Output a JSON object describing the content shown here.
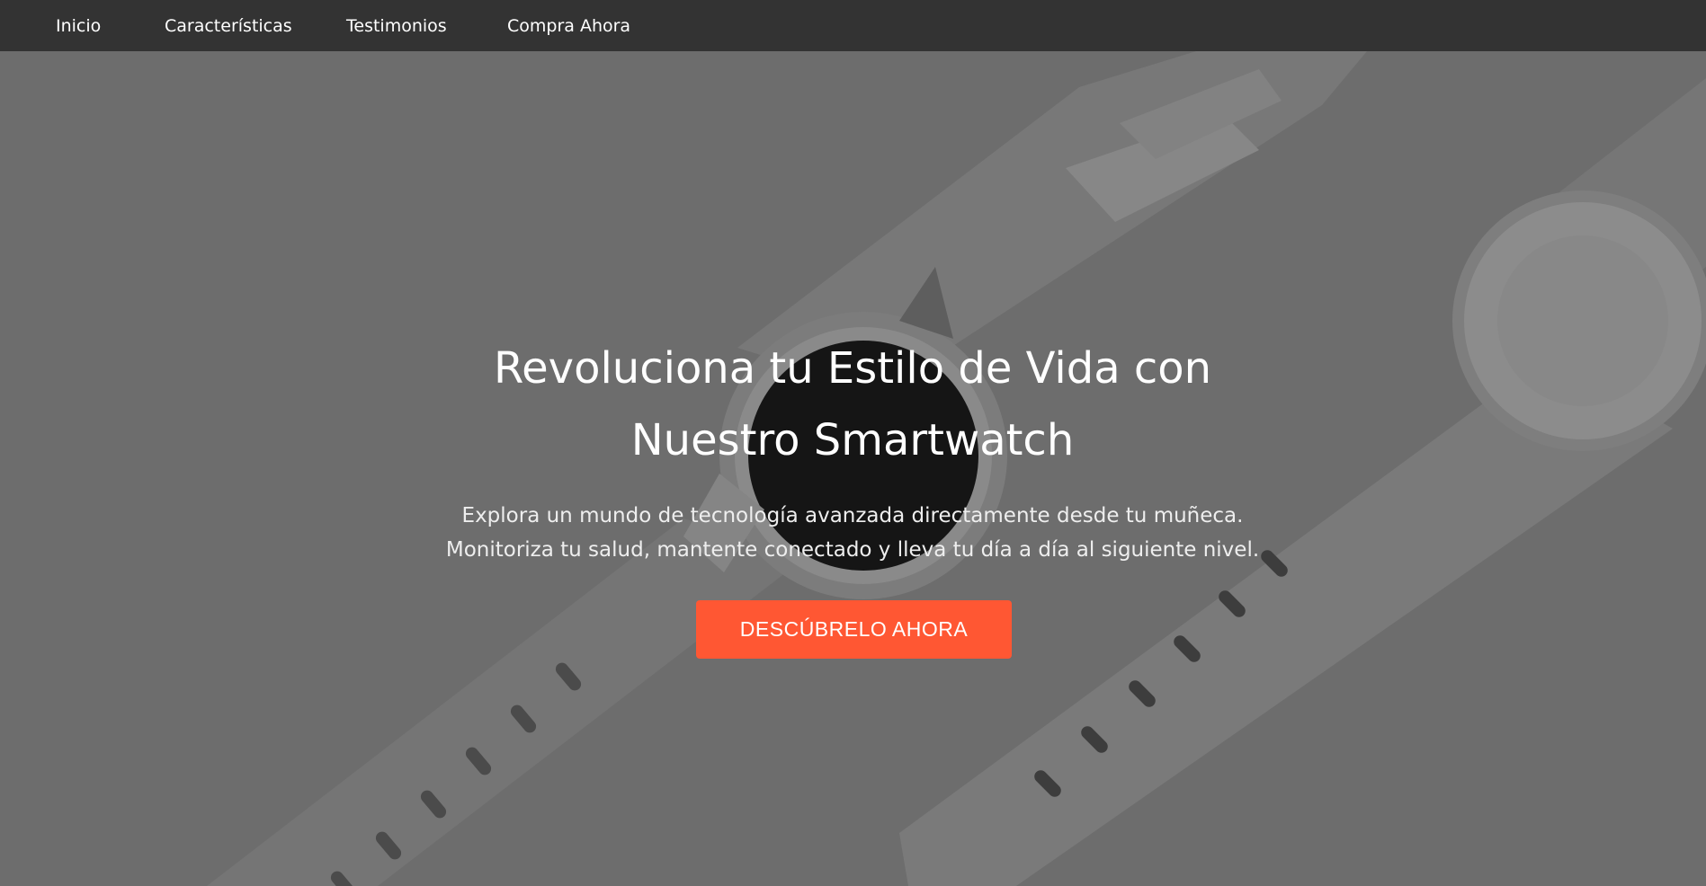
{
  "nav": {
    "items": [
      {
        "label": "Inicio"
      },
      {
        "label": "Características"
      },
      {
        "label": "Testimonios"
      },
      {
        "label": "Compra Ahora"
      }
    ]
  },
  "hero": {
    "title": "Revoluciona tu Estilo de Vida con Nuestro Smartwatch",
    "subtitle_line1": "Explora un mundo de tecnología avanzada directamente desde tu muñeca.",
    "subtitle_line2": "Monitoriza tu salud, mantente conectado y lleva tu día a día al siguiente nivel.",
    "cta_label": "DESCÚBRELO AHORA",
    "background_image": "smartwatch-product-photo"
  },
  "colors": {
    "nav_background": "#333333",
    "hero_overlay": "#6d6d6d",
    "cta": "#ff5733",
    "text": "#ffffff"
  }
}
